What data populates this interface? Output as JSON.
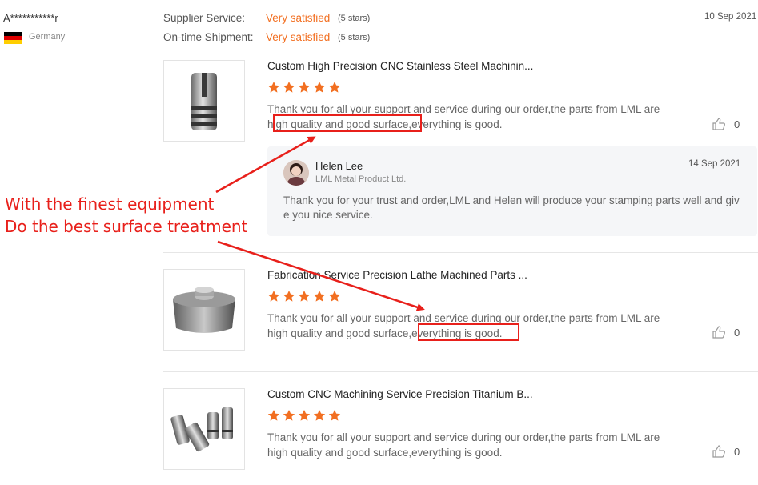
{
  "reviewer": {
    "name": "A***********r",
    "country": "Germany",
    "flag_colors": [
      "#000000",
      "#dd0000",
      "#ffce00"
    ]
  },
  "ratings": [
    {
      "label": "Supplier Service:",
      "value": "Very satisfied",
      "stars": "(5 stars)"
    },
    {
      "label": "On-time Shipment:",
      "value": "Very satisfied",
      "stars": "(5 stars)"
    }
  ],
  "review_date": "10 Sep 2021",
  "products": [
    {
      "title": "Custom High Precision CNC Stainless Steel Machinin...",
      "rating": 5,
      "review": "Thank you for all your support and service during our order,the parts from LML are high quality and good surface,everything is good.",
      "likes": "0"
    },
    {
      "title": "Fabrication Service Precision Lathe Machined Parts ...",
      "rating": 5,
      "review": "Thank you for all your support and service during our order,the parts from LML are high quality and good surface,everything is good.",
      "likes": "0"
    },
    {
      "title": "Custom CNC Machining Service Precision Titanium B...",
      "rating": 5,
      "review": "Thank you for all your support and service during our order,the parts from LML are high quality and good surface,everything is good.",
      "likes": "0"
    }
  ],
  "reply": {
    "name": "Helen Lee",
    "company": "LML Metal Product Ltd.",
    "date": "14 Sep 2021",
    "text": "Thank you for your trust and order,LML and Helen will produce your stamping parts well and give you nice service."
  },
  "annotation": {
    "line1": "With the finest equipment",
    "line2": "Do the best surface treatment",
    "color": "#e8201b"
  },
  "colors": {
    "accent": "#f26f21",
    "star": "#f26f21"
  }
}
